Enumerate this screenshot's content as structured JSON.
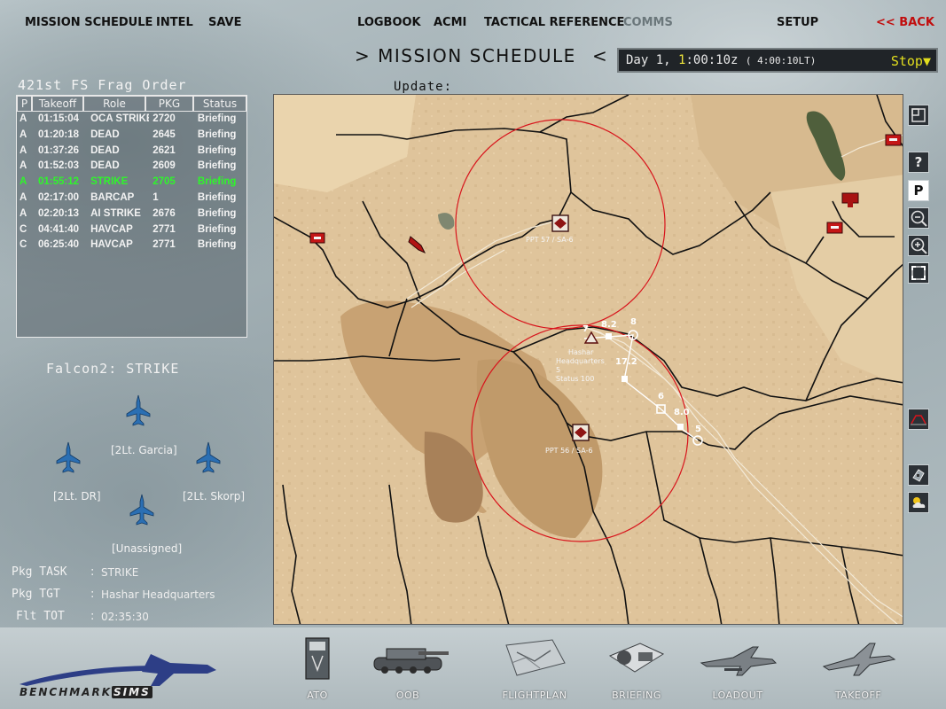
{
  "top_menu": {
    "items": [
      "MISSION SCHEDULE",
      "INTEL",
      "SAVE",
      "LOGBOOK",
      "ACMI",
      "TACTICAL REFERENCE",
      "COMMS",
      "SETUP"
    ],
    "back": "<< BACK",
    "disabled": [
      "COMMS"
    ]
  },
  "screen_title": "> MISSION SCHEDULE",
  "screen_title_tail": "<",
  "clock": {
    "day_label": "Day",
    "day_number": "1,",
    "hour": "1",
    "rest": ":00:10z",
    "local": "( 4:00:10LT)",
    "control": "Stop▼"
  },
  "update_label": "Update:",
  "frag_order": {
    "title": "421st FS Frag Order",
    "columns": [
      "P",
      "Takeoff",
      "Role",
      "PKG",
      "Status"
    ],
    "rows": [
      {
        "p": "A",
        "takeoff": "01:15:04",
        "role": "OCA STRIKE",
        "pkg": "2720",
        "status": "Briefing"
      },
      {
        "p": "A",
        "takeoff": "01:20:18",
        "role": "DEAD",
        "pkg": "2645",
        "status": "Briefing"
      },
      {
        "p": "A",
        "takeoff": "01:37:26",
        "role": "DEAD",
        "pkg": "2621",
        "status": "Briefing"
      },
      {
        "p": "A",
        "takeoff": "01:52:03",
        "role": "DEAD",
        "pkg": "2609",
        "status": "Briefing"
      },
      {
        "p": "A",
        "takeoff": "01:55:12",
        "role": "STRIKE",
        "pkg": "2705",
        "status": "Briefing"
      },
      {
        "p": "A",
        "takeoff": "02:17:00",
        "role": "BARCAP",
        "pkg": "1",
        "status": "Briefing"
      },
      {
        "p": "A",
        "takeoff": "02:20:13",
        "role": "AI STRIKE",
        "pkg": "2676",
        "status": "Briefing"
      },
      {
        "p": "C",
        "takeoff": "04:41:40",
        "role": "HAVCAP",
        "pkg": "2771",
        "status": "Briefing"
      },
      {
        "p": "C",
        "takeoff": "06:25:40",
        "role": "HAVCAP",
        "pkg": "2771",
        "status": "Briefing"
      }
    ],
    "selected_index": 4
  },
  "flight": {
    "name": "Falcon2: STRIKE",
    "pilots": [
      "[2Lt. Garcia]",
      "[2Lt. DR]",
      "[2Lt. Skorp]",
      "[Unassigned]"
    ]
  },
  "package": [
    {
      "label": "Pkg TASK",
      "value": "STRIKE"
    },
    {
      "label": "Pkg TGT",
      "value": "Hashar Headquarters"
    },
    {
      "label": "Flt TOT",
      "value": "02:35:30"
    }
  ],
  "map": {
    "sam_labels": [
      "PPT 57 / SA-6",
      "PPT 56 / SA-6"
    ],
    "target_label": [
      "Hashar",
      "Headquarters",
      "5",
      "Status 100"
    ],
    "waypoint_labels": [
      "7",
      "8.2",
      "8",
      "17.2",
      "6",
      "8.0",
      "5"
    ],
    "threat_ring_color": "#d8141c"
  },
  "map_tools": [
    "maximize-icon",
    "help-icon",
    "p-icon",
    "zoom-out-icon",
    "zoom-in-icon",
    "fit-icon",
    "elevation-icon",
    "recon-icon",
    "weather-icon"
  ],
  "bottom_nav": [
    "ATO",
    "OOB",
    "FLIGHTPLAN",
    "BRIEFING",
    "LOADOUT",
    "TAKEOFF"
  ],
  "logo": {
    "main": "BENCHMARK",
    "accent": "SIMS"
  },
  "colors": {
    "selected_row": "#2ff52b",
    "back": "#c10d0d",
    "clock_accent": "#f0e63c"
  }
}
